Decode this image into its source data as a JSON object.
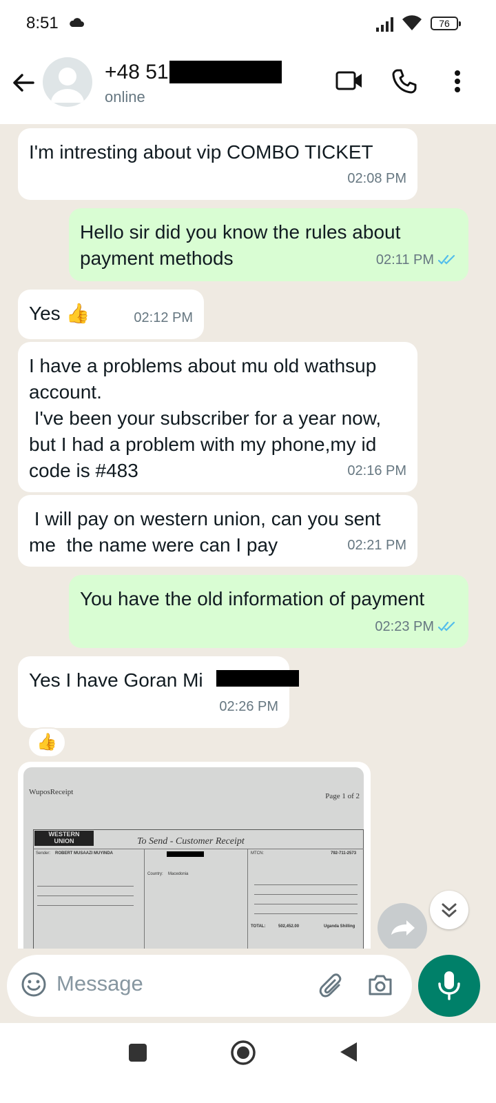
{
  "status_bar": {
    "time": "8:51",
    "battery": "76"
  },
  "header": {
    "contact_name": "+48 51",
    "contact_status": "online"
  },
  "messages": [
    {
      "direction": "in",
      "text": "I'm intresting about vip COMBO TICKET",
      "time": "02:08 PM"
    },
    {
      "direction": "out",
      "text": "Hello sir did you know the rules about\npayment methods",
      "time": "02:11 PM",
      "read": true
    },
    {
      "direction": "in",
      "text": "Yes 👍",
      "time": "02:12 PM"
    },
    {
      "direction": "in",
      "text": "I have a problems about mu old wathsup\naccount.\n I've been your subscriber for a year now,\nbut I had a problem with my phone,my id\ncode is #483",
      "time": "02:16 PM"
    },
    {
      "direction": "in",
      "text": " I will pay on western union, can you sent\nme  the name were can I pay",
      "time": "02:21 PM"
    },
    {
      "direction": "out",
      "text": "You have the old information of payment",
      "time": "02:23 PM",
      "read": true
    },
    {
      "direction": "in",
      "text": "Yes I have Goran Mi",
      "time": "02:26 PM"
    }
  ],
  "reaction": "👍",
  "receipt_image": {
    "title": "WuposReceipt",
    "page": "Page 1 of 2",
    "logo_line1": "WESTERN",
    "logo_line2": "UNION",
    "heading": "To Send - Customer Receipt",
    "sender_label": "Sender:",
    "sender_name": "ROBERT MUSAAZI MUYINDA",
    "mtcn_label": "MTCN:",
    "mtcn": "792-711-2573",
    "country_label": "Country:",
    "country": "Macedonia",
    "total_label": "TOTAL:",
    "total": "502,452.00",
    "currency": "Uganda Shilling"
  },
  "input": {
    "placeholder": "Message"
  },
  "colors": {
    "accent": "#008069",
    "outgoing_bubble": "#d9fdd3",
    "incoming_bubble": "#ffffff",
    "chat_bg": "#efeae2",
    "read_ticks": "#53bdeb"
  }
}
